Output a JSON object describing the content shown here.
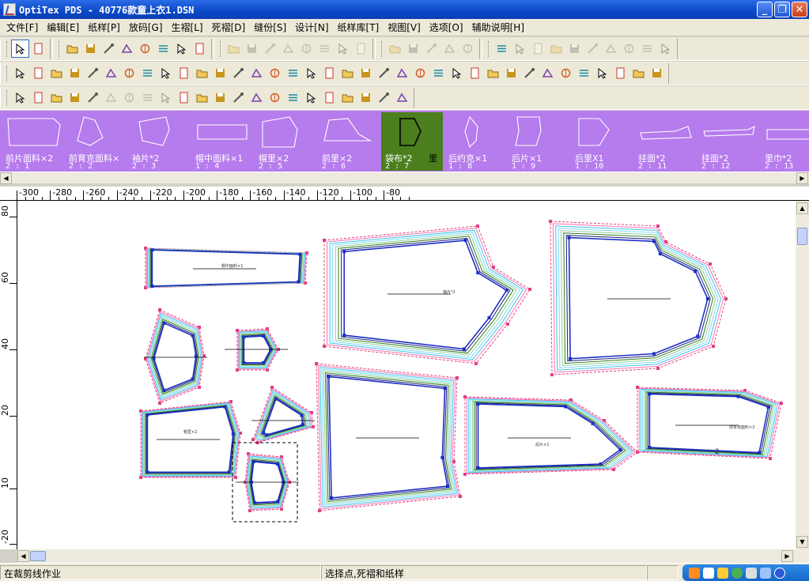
{
  "window": {
    "title": "OptiTex PDS - 40776款童上衣1.DSN",
    "btn_minimize": "_",
    "btn_restore": "❐",
    "btn_close": "✕"
  },
  "menu": [
    "文件[F]",
    "编辑[E]",
    "纸样[P]",
    "放码[G]",
    "生褶[L]",
    "死褶[D]",
    "缝份[S]",
    "设计[N]",
    "纸样库[T]",
    "视图[V]",
    "选项[O]",
    "辅助说明[H]"
  ],
  "toolbar_icons": {
    "row1": [
      "select-arrow",
      "new-file",
      "open-folder",
      "save",
      "print",
      "plot",
      "excel",
      "preview",
      "help",
      "context-help",
      "grade-disabled-1",
      "grade-disabled-2",
      "grade-disabled-3",
      "grade-disabled-4",
      "grade-disabled-5",
      "grade-disabled-6",
      "measure-disabled",
      "piece-disabled",
      "split-disabled",
      "notch-disabled",
      "cut-disabled",
      "stripes-disabled",
      "circle-disabled",
      "tag",
      "angle-disabled",
      "fold-disabled",
      "weight-disabled",
      "line-disabled",
      "box-disabled",
      "mirror-disabled",
      "tool-disabled-1",
      "tool-disabled-2",
      "tool-disabled-3"
    ],
    "row2": [
      "eraser",
      "line-tool",
      "angle-tool",
      "perp-tool",
      "offset-tool",
      "parallel-tool",
      "rect-tool",
      "cross-tool",
      "grid-tool",
      "lines-tool",
      "dart-tool",
      "pleat-tool",
      "fold-tool",
      "palette-tool",
      "sphere-tool",
      "pen-tool",
      "text-tool",
      "text-v-tool",
      "curve-tool",
      "wave-tool",
      "notch-tool",
      "gray-tool",
      "measure-tool",
      "triangle-tool",
      "copy-tool",
      "paste-tool",
      "scissors-tool",
      "stamp-tool",
      "pencil-tool",
      "scissors2-tool",
      "label-tool",
      "brush-tool",
      "book-tool",
      "book2-tool",
      "dice-tool",
      "compass-tool"
    ],
    "row3": [
      "move-point",
      "rotate-point",
      "scale-point",
      "shift-point",
      "stack-tool",
      "ruler-disabled",
      "split-disabled",
      "cut-disabled",
      "scissors-disabled",
      "hand-tool",
      "grab-tool",
      "rect-select",
      "curve-select",
      "cw-tool",
      "gear-tool",
      "weight-tool",
      "flip-v",
      "flip-h",
      "mirror-tool",
      "arrows-tool",
      "copy-piece",
      "paste-piece"
    ]
  },
  "pieces": [
    {
      "name": "前片面料×2",
      "num": "2 : 1"
    },
    {
      "name": "前育克面料×",
      "num": "2 : 2"
    },
    {
      "name": "袖片*2",
      "num": "2 : 3"
    },
    {
      "name": "帽中面料×1",
      "num": "1 : 4"
    },
    {
      "name": "帽里×2",
      "num": "2 : 5"
    },
    {
      "name": "前里×2",
      "num": "2 : 6"
    },
    {
      "name": "袋布*2",
      "num": "2 : 7",
      "extra": "里",
      "active": true
    },
    {
      "name": "后约克×1",
      "num": "1 : 8"
    },
    {
      "name": "后片×1",
      "num": "1 : 9"
    },
    {
      "name": "后里X1",
      "num": "1 : 10"
    },
    {
      "name": "挂面*2",
      "num": "2 : 11"
    },
    {
      "name": "挂面*2",
      "num": "2 : 12"
    },
    {
      "name": "里巾*2",
      "num": "2 : 13"
    }
  ],
  "hruler": [
    "-300",
    "-280",
    "-260",
    "-240",
    "-220",
    "-200",
    "-180",
    "-160",
    "-140",
    "-120",
    "-100",
    "-80"
  ],
  "vruler": [
    "80",
    "60",
    "40",
    "20",
    "10",
    "-20"
  ],
  "canvas_labels": {
    "hood_center": "帽中面料×1",
    "sleeve": "袖片*2",
    "hood_lining": "帽里×2",
    "back_piece": "后片×1",
    "yoke": "前育克面料×2",
    "yoke_num": "2"
  },
  "status": {
    "left": "在裁剪线作业",
    "middle": "选择点,死褶和纸样"
  },
  "colors": {
    "piece_bar": "#b67bed",
    "active_piece": "#4b7f1d",
    "grade_pink": "#e0407f",
    "grade_blue": "#1c2fc4",
    "grade_green": "#2e7d1f",
    "grade_cyan": "#3cc6e8"
  }
}
